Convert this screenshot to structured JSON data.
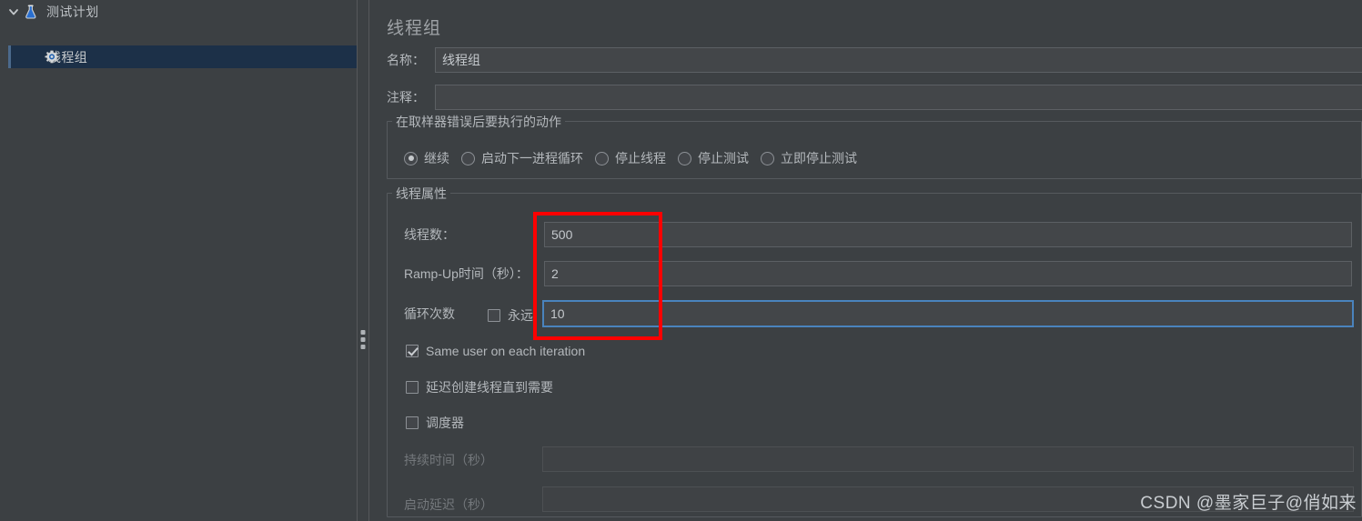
{
  "colors": {
    "background": "#3c4043",
    "panel": "#3c4043",
    "selection": "#1c3048",
    "accent": "#4a83bd",
    "annotation": "#ff0000",
    "text": "#b4b8bc",
    "text_disabled": "#74787c"
  },
  "tree": {
    "items": [
      {
        "label": "测试计划",
        "icon": "flask-icon",
        "selected": false,
        "expanded": true,
        "depth": 0
      },
      {
        "label": "线程组",
        "icon": "gear-icon",
        "selected": true,
        "expanded": false,
        "depth": 1
      }
    ]
  },
  "panel": {
    "title": "线程组",
    "name_field": {
      "label": "名称：",
      "value": "线程组",
      "placeholder": ""
    },
    "comment_field": {
      "label": "注释：",
      "value": "",
      "placeholder": ""
    },
    "error_action": {
      "legend": "在取样器错误后要执行的动作",
      "options": [
        {
          "label": "继续",
          "checked": true
        },
        {
          "label": "启动下一进程循环",
          "checked": false
        },
        {
          "label": "停止线程",
          "checked": false
        },
        {
          "label": "停止测试",
          "checked": false
        },
        {
          "label": "立即停止测试",
          "checked": false
        }
      ]
    },
    "thread_properties": {
      "legend": "线程属性",
      "num_threads": {
        "label": "线程数：",
        "value": "500"
      },
      "ramp_up": {
        "label": "Ramp-Up时间（秒）：",
        "value": "2"
      },
      "loop_count": {
        "label": "循环次数",
        "forever_label": "永远",
        "forever_checked": false,
        "value": "10",
        "focused": true
      },
      "checkboxes": [
        {
          "label": "Same user on each iteration",
          "checked": true
        },
        {
          "label": "延迟创建线程直到需要",
          "checked": false
        },
        {
          "label": "调度器",
          "checked": false
        }
      ],
      "duration": {
        "label": "持续时间（秒）",
        "value": "",
        "disabled": true
      },
      "startup_delay": {
        "label": "启动延迟（秒）",
        "value": "",
        "disabled": true
      }
    }
  },
  "watermark": {
    "text": "CSDN @墨家巨子@俏如来"
  }
}
